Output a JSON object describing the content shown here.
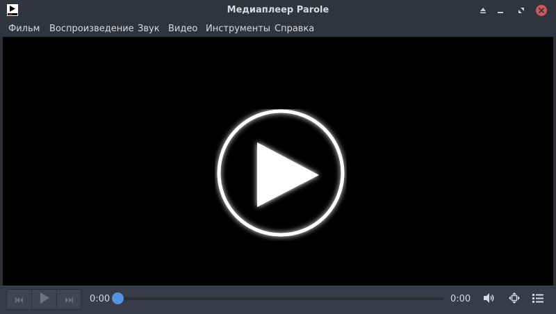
{
  "window": {
    "title": "Медиаплеер Parole",
    "controls": [
      "eject-icon",
      "minimize-icon",
      "restore-icon",
      "close-icon"
    ],
    "close_color": "#cc575d"
  },
  "menu": [
    {
      "label": "Фильм"
    },
    {
      "label": "Воспроизведение"
    },
    {
      "label": "Звук"
    },
    {
      "label": "Видео"
    },
    {
      "label": "Инструменты"
    },
    {
      "label": "Справка"
    }
  ],
  "player": {
    "elapsed": "0:00",
    "duration": "0:00",
    "progress": 0,
    "accent": "#5294e2",
    "buttons": [
      "previous-icon",
      "play-icon",
      "next-icon"
    ],
    "right_icons": [
      "volume-icon",
      "fullscreen-icon",
      "playlist-icon"
    ]
  }
}
